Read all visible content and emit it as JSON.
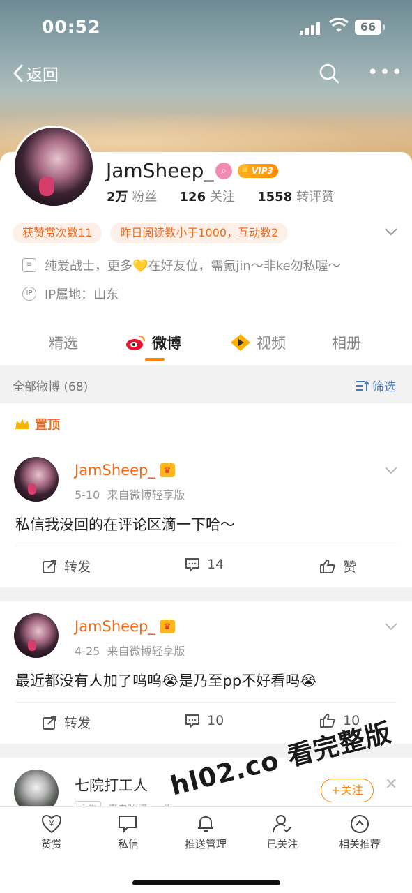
{
  "status_bar": {
    "time": "00:52",
    "battery": "66"
  },
  "nav": {
    "back_label": "返回"
  },
  "profile": {
    "username": "JamSheep_",
    "vip_label": "VIP3",
    "stats": [
      {
        "value": "2万",
        "label": "粉丝"
      },
      {
        "value": "126",
        "label": "关注"
      },
      {
        "value": "1558",
        "label": "转评赞"
      }
    ],
    "tags": [
      "获赞赏次数11",
      "昨日阅读数小于1000，互动数2"
    ],
    "bio": "纯爱战士，更多💛在好友位，需氪jin～非ke勿私喔～",
    "ip_location": "IP属地：山东"
  },
  "tabs": [
    {
      "label": "精选"
    },
    {
      "label": "微博"
    },
    {
      "label": "视频"
    },
    {
      "label": "相册"
    }
  ],
  "filter_bar": {
    "all_label": "全部微博 (68)",
    "filter_label": "筛选"
  },
  "pinned_label": "置顶",
  "posts": [
    {
      "name": "JamSheep_",
      "date": "5-10",
      "source": "来自微博轻享版",
      "text": "私信我没回的在评论区滴一下哈～",
      "repost": "转发",
      "comments": "14",
      "likes": "赞"
    },
    {
      "name": "JamSheep_",
      "date": "4-25",
      "source": "来自微博轻享版",
      "text": "最近都没有人加了呜呜😭是乃至pp不好看吗😭",
      "repost": "转发",
      "comments": "10",
      "likes": "10"
    }
  ],
  "ad_post": {
    "name": "七院打工人",
    "ad_tag": "广告",
    "source": "来自微博 weibo.com",
    "follow_label": "+关注"
  },
  "bottom_bar": [
    {
      "label": "赞赏",
      "icon": "reward-icon"
    },
    {
      "label": "私信",
      "icon": "message-icon"
    },
    {
      "label": "推送管理",
      "icon": "bell-icon"
    },
    {
      "label": "已关注",
      "icon": "followed-user-icon"
    },
    {
      "label": "相关推荐",
      "icon": "compass-icon"
    }
  ],
  "watermark": "hl02.co 看完整版",
  "colors": {
    "accent": "#ff8200",
    "name_orange": "#ee6a1e",
    "link_blue": "#4a78b8"
  }
}
